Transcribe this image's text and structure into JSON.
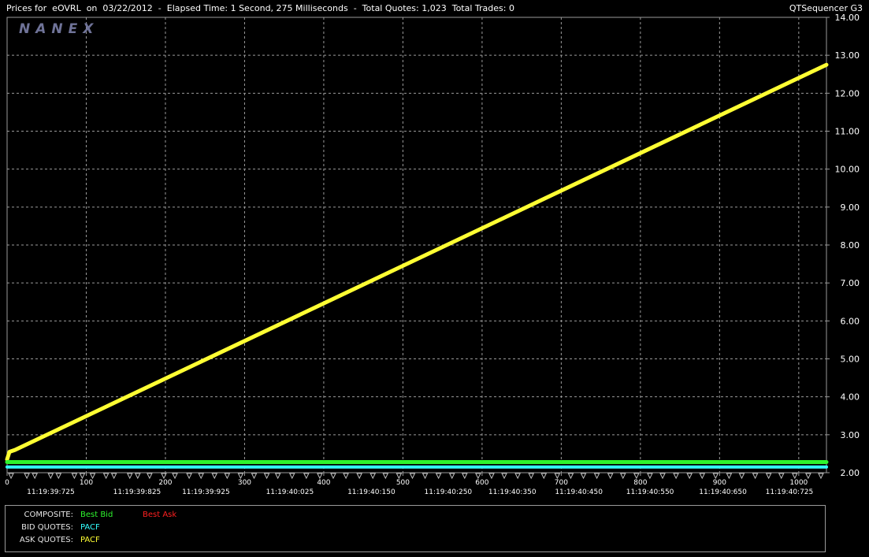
{
  "window": {
    "title_left": "Prices for  eOVRL  on  03/22/2012  -  Elapsed Time: 1 Second, 275 Milliseconds  -  Total Quotes: 1,023  Total Trades: 0",
    "title_right": "QTSequencer G3",
    "logo_text": "NANEX"
  },
  "colors": {
    "background": "#000000",
    "grid": "#9a9a9a",
    "best_bid": "#2ef52e",
    "best_ask": "#ff2020",
    "bid_pacf": "#33ffff",
    "ask_pacf": "#ffff33",
    "logo": "#6f7398"
  },
  "legend": {
    "rows": [
      {
        "label": "COMPOSITE:",
        "items": [
          {
            "text": "Best Bid",
            "color": "#2ef52e"
          },
          {
            "text": "Best Ask",
            "color": "#ff2020"
          }
        ]
      },
      {
        "label": "BID QUOTES:",
        "items": [
          {
            "text": "PACF",
            "color": "#33ffff"
          }
        ]
      },
      {
        "label": "ASK QUOTES:",
        "items": [
          {
            "text": "PACF",
            "color": "#ffff33"
          }
        ]
      }
    ]
  },
  "chart_data": {
    "type": "line",
    "xlim": [
      0,
      1035
    ],
    "ylim": [
      2.0,
      14.0
    ],
    "grid": true,
    "x_ticks": [
      0,
      100,
      200,
      300,
      400,
      500,
      600,
      700,
      800,
      900,
      1000
    ],
    "y_ticks": [
      "2.00",
      "3.00",
      "4.00",
      "5.00",
      "6.00",
      "7.00",
      "8.00",
      "9.00",
      "10.00",
      "11.00",
      "12.00",
      "13.00",
      "14.00"
    ],
    "time_labels": [
      {
        "x": 25,
        "text": "11:19:39:725"
      },
      {
        "x": 134,
        "text": "11:19:39:825"
      },
      {
        "x": 221,
        "text": "11:19:39:925"
      },
      {
        "x": 327,
        "text": "11:19:40:025"
      },
      {
        "x": 430,
        "text": "11:19:40:150"
      },
      {
        "x": 527,
        "text": "11:19:40:250"
      },
      {
        "x": 608,
        "text": "11:19:40:350"
      },
      {
        "x": 692,
        "text": "11:19:40:450"
      },
      {
        "x": 782,
        "text": "11:19:40:550"
      },
      {
        "x": 874,
        "text": "11:19:40:650"
      },
      {
        "x": 958,
        "text": "11:19:40:725"
      }
    ],
    "triangle_markers": [
      5,
      25,
      35,
      55,
      65,
      85,
      95,
      108,
      125,
      135,
      155,
      165,
      180,
      198,
      212,
      230,
      245,
      262,
      278,
      295,
      312,
      328,
      342,
      360,
      378,
      395,
      412,
      428,
      445,
      462,
      478,
      495,
      512,
      528,
      545,
      562,
      578,
      595,
      612,
      628,
      645,
      662,
      678,
      695,
      712,
      728,
      745,
      762,
      778,
      795,
      812,
      828,
      845,
      862,
      878,
      895,
      912,
      928,
      945,
      962,
      978,
      995,
      1012,
      1028
    ],
    "series": [
      {
        "name": "PACF",
        "color": "#ffff33",
        "x": [
          0,
          3,
          10,
          1035
        ],
        "y": [
          2.35,
          2.55,
          2.6,
          12.75
        ]
      },
      {
        "name": "Best Bid",
        "color": "#2ef52e",
        "x": [
          0,
          1035
        ],
        "y": [
          2.28,
          2.28
        ]
      },
      {
        "name": "PACF",
        "color": "#33ffff",
        "x": [
          0,
          1035
        ],
        "y": [
          2.15,
          2.15
        ]
      }
    ]
  }
}
